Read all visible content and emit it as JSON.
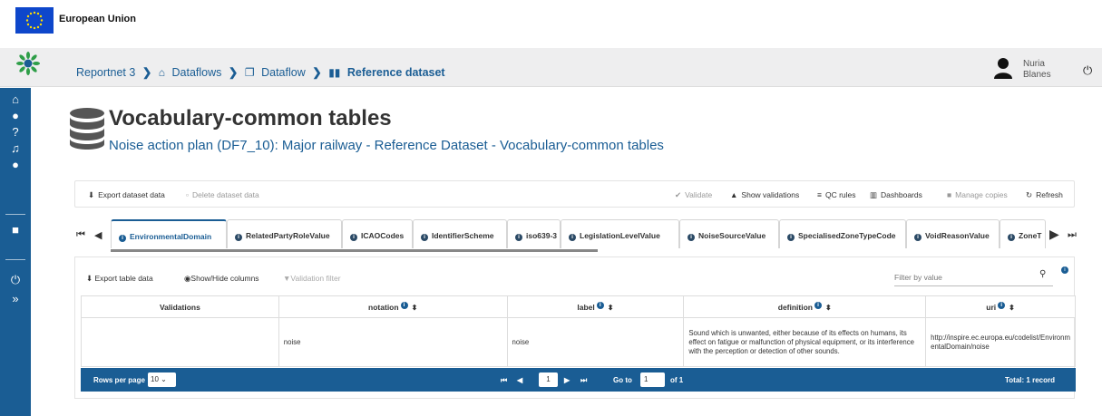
{
  "eu": {
    "label": "European Union"
  },
  "breadcrumb": {
    "items": [
      "Reportnet 3",
      "Dataflows",
      "Dataflow",
      "Reference dataset"
    ]
  },
  "user": {
    "first": "Nuria",
    "last": "Blanes"
  },
  "page": {
    "title": "Vocabulary-common tables",
    "subtitle": "Noise action plan (DF7_10): Major railway - Reference Dataset - Vocabulary-common tables"
  },
  "toolbar": {
    "export": "Export dataset data",
    "delete": "Delete dataset data",
    "validate": "Validate",
    "show_validations": "Show validations",
    "qc_rules": "QC rules",
    "dashboards": "Dashboards",
    "manage_copies": "Manage copies",
    "refresh": "Refresh"
  },
  "tabs": [
    "EnvironmentalDomain",
    "RelatedPartyRoleValue",
    "ICAOCodes",
    "IdentifierScheme",
    "iso639-3",
    "LegislationLevelValue",
    "NoiseSourceValue",
    "SpecialisedZoneTypeCode",
    "VoidReasonValue",
    "ZoneT"
  ],
  "table_toolbar": {
    "export": "Export table data",
    "show_hide": "Show/Hide columns",
    "validation_filter": "Validation filter",
    "filter_placeholder": "Filter by value"
  },
  "table": {
    "headers": [
      "Validations",
      "notation",
      "label",
      "definition",
      "uri"
    ],
    "rows": [
      {
        "validations": "",
        "notation": "noise",
        "label": "noise",
        "definition": "Sound which is unwanted, either because of its effects on humans, its effect on fatigue or malfunction of physical equipment, or its interference with the perception or detection of other sounds.",
        "uri": "http://inspire.ec.europa.eu/codelist/EnvironmentalDomain/noise"
      }
    ]
  },
  "pager": {
    "rows_per_page_label": "Rows per page",
    "rows_per_page": "10",
    "page": "1",
    "goto_label": "Go to",
    "goto_value": "1",
    "of_label": "of 1",
    "total": "Total: 1 record"
  },
  "colors": {
    "primary": "#1a5d94",
    "eu_blue": "#0e47cb",
    "eu_star": "#ffdd00"
  },
  "icons": {
    "sidebar": [
      "home-icon",
      "user-icon",
      "help-icon",
      "bell-icon",
      "chat-icon",
      "lock-icon",
      "power-icon",
      "expand-icon"
    ]
  }
}
